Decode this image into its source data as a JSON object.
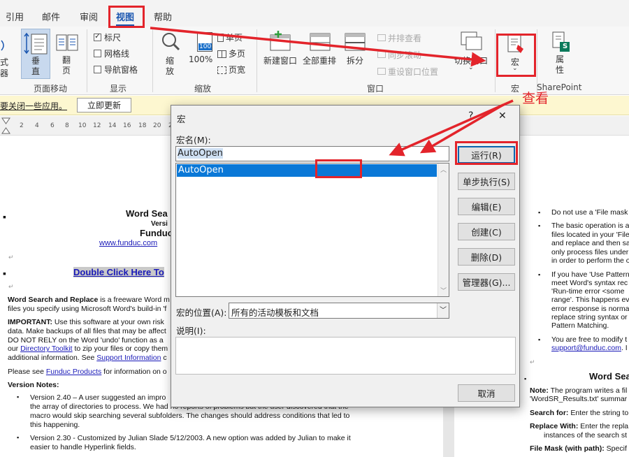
{
  "tabs": [
    "引用",
    "邮件",
    "审阅",
    "视图",
    "帮助"
  ],
  "active_tab": "视图",
  "ribbon": {
    "partial_left_top": "式",
    "partial_left_bottom": "器",
    "vertical": "垂直",
    "flip": "翻页",
    "ruler": "标尺",
    "gridlines": "网格线",
    "nav_pane": "导航窗格",
    "zoom": "缩放",
    "zoom100": "100%",
    "one_page": "单页",
    "multi_page": "多页",
    "page_width": "页宽",
    "zoom_badge": "100",
    "new_window": "新建窗口",
    "arrange_all": "全部重排",
    "split": "拆分",
    "side_by_side": "并排查看",
    "sync_scroll": "同步滚动",
    "reset_pos": "重设窗口位置",
    "switch_window": "切换窗口",
    "macro": "宏",
    "properties": "属性",
    "sharepoint_badge": "S",
    "groups": {
      "page_move": "页面移动",
      "show": "显示",
      "zoom": "缩放",
      "window": "窗口",
      "macro": "宏",
      "sharepoint": "SharePoint"
    }
  },
  "infobar": {
    "text": "要关闭一些应用。",
    "button": "立即更新"
  },
  "ruler_ticks": [
    "2",
    "4",
    "6",
    "8",
    "10",
    "12",
    "14",
    "16",
    "18",
    "20",
    "22",
    "24"
  ],
  "annotation": "查看",
  "document": {
    "title": "Word Sea",
    "version": "Versi",
    "funduc": "Funduc",
    "url": "www.funduc.com",
    "double_click": "Double Click Here To",
    "p1_bold": "Word Search and Replace",
    "p1_rest": " is a freeware Word m",
    "p1_line2": "files you specify using Microsoft Word's build-in 'f",
    "important_bold": "IMPORTANT:",
    "important_rest": " Use this software at your own risk",
    "imp_l2": "data. Make backups of all files that may be affect",
    "imp_l3": "DO NOT RELY on the Word 'undo' function as a",
    "imp_l4a": "our ",
    "imp_l4_link": "Directory Toolkit",
    "imp_l4b": " to zip your files or copy them",
    "imp_l5a": "additional information. See ",
    "imp_l5_link": "Support Information",
    "imp_l5b": " c",
    "see_a": "Please see ",
    "see_link": "Funduc Products",
    "see_b": " for information on o",
    "version_notes": "Version Notes:",
    "vn1_l1": "Version 2.40 – A user suggested an impro",
    "vn1_l2": "the array of directories to process. We had no reports of problems but the user discovered that the",
    "vn1_l3": "macro would skip searching several subfolders. The changes should address conditions that led to",
    "vn1_l4": "this happening.",
    "vn2_l1": "Version 2.30 - Customized by Julian Slade 5/12/2003. A new option was added by Julian to make it",
    "vn2_l2": "easier to handle Hyperlink fields.",
    "right": {
      "r1": "Do not use a 'File mask",
      "r2a": "The basic operation is a",
      "r2b": "files located in your 'File",
      "r2c": "and replace and then sa",
      "r2d": "only process files under",
      "r2e": "in order to perform the o",
      "r3a": "If you have 'Use Pattern",
      "r3b": "meet Word's syntax rec",
      "r3c": "'Run-time error <some",
      "r3d": "range'. This happens ev",
      "r3e": "error response is norma",
      "r3f": "replace string syntax or",
      "r3g": "Pattern Matching.",
      "r4a": "You are free to modify t",
      "r4b_link": "support@funduc.com",
      "r4b_rest": ". I",
      "heading": "Word Sea",
      "note_bold": "Note:",
      "note_rest": " The program writes a fil",
      "note_l2": "'WordSR_Results.txt' summar",
      "search_bold": "Search for:",
      "search_rest": " Enter the string to",
      "replace_bold": "Replace With:",
      "replace_rest": " Enter the repla",
      "replace_l2": "instances of the search st",
      "mask_bold": "File Mask (with path):",
      "mask_rest": " Specif"
    }
  },
  "dialog": {
    "title": "宏",
    "help": "?",
    "close": "✕",
    "name_label": "宏名(M):",
    "name_value": "AutoOpen",
    "list_items": [
      "AutoOpen"
    ],
    "buttons": [
      "运行(R)",
      "单步执行(S)",
      "编辑(E)",
      "创建(C)",
      "删除(D)",
      "管理器(G)..."
    ],
    "location_label": "宏的位置(A):",
    "location_value": "所有的活动模板和文档",
    "desc_label": "说明(I):",
    "cancel": "取消"
  },
  "colors": {
    "highlight_border": "#e3242b",
    "selection": "#0a78d7",
    "accent": "#1a56b0"
  }
}
